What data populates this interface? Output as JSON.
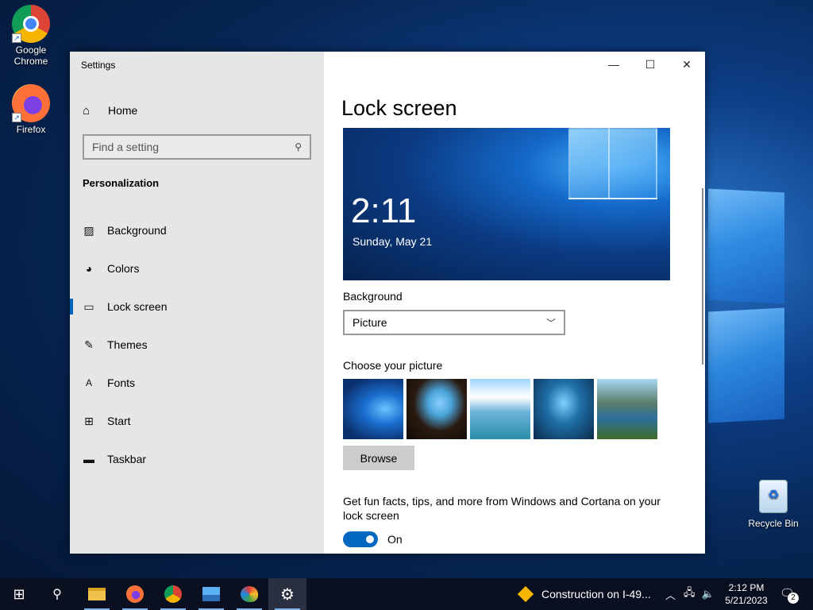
{
  "desktop": {
    "icons": [
      {
        "label": "Google Chrome",
        "icon": "chrome-icon"
      },
      {
        "label": "Firefox",
        "icon": "firefox-icon"
      },
      {
        "label": "Recycle Bin",
        "icon": "recycle-bin-icon"
      }
    ]
  },
  "window": {
    "title": "Settings",
    "controls": {
      "minimize": "—",
      "maximize": "☐",
      "close": "✕"
    }
  },
  "sidebar": {
    "home_label": "Home",
    "search_placeholder": "Find a setting",
    "section_heading": "Personalization",
    "items": [
      {
        "label": "Background",
        "icon": "picture-icon",
        "active": false
      },
      {
        "label": "Colors",
        "icon": "palette-icon",
        "active": false
      },
      {
        "label": "Lock screen",
        "icon": "lock-screen-icon",
        "active": true
      },
      {
        "label": "Themes",
        "icon": "themes-icon",
        "active": false
      },
      {
        "label": "Fonts",
        "icon": "fonts-icon",
        "active": false
      },
      {
        "label": "Start",
        "icon": "start-icon",
        "active": false
      },
      {
        "label": "Taskbar",
        "icon": "taskbar-icon",
        "active": false
      }
    ]
  },
  "main": {
    "title": "Lock screen",
    "preview": {
      "time": "2:11",
      "date": "Sunday, May 21"
    },
    "background_label": "Background",
    "background_value": "Picture",
    "choose_picture_label": "Choose your picture",
    "browse_label": "Browse",
    "fun_facts_text": "Get fun facts, tips, and more from Windows and Cortana on your lock screen",
    "toggle_state": "On",
    "toggle_on": true
  },
  "taskbar": {
    "news_text": "Construction on I-49...",
    "clock_time": "2:12 PM",
    "clock_date": "5/21/2023",
    "notification_count": "2"
  },
  "colors": {
    "accent": "#0067c0",
    "sidebar_bg": "#e6e6e6",
    "taskbar_bg": "#0b1020"
  }
}
